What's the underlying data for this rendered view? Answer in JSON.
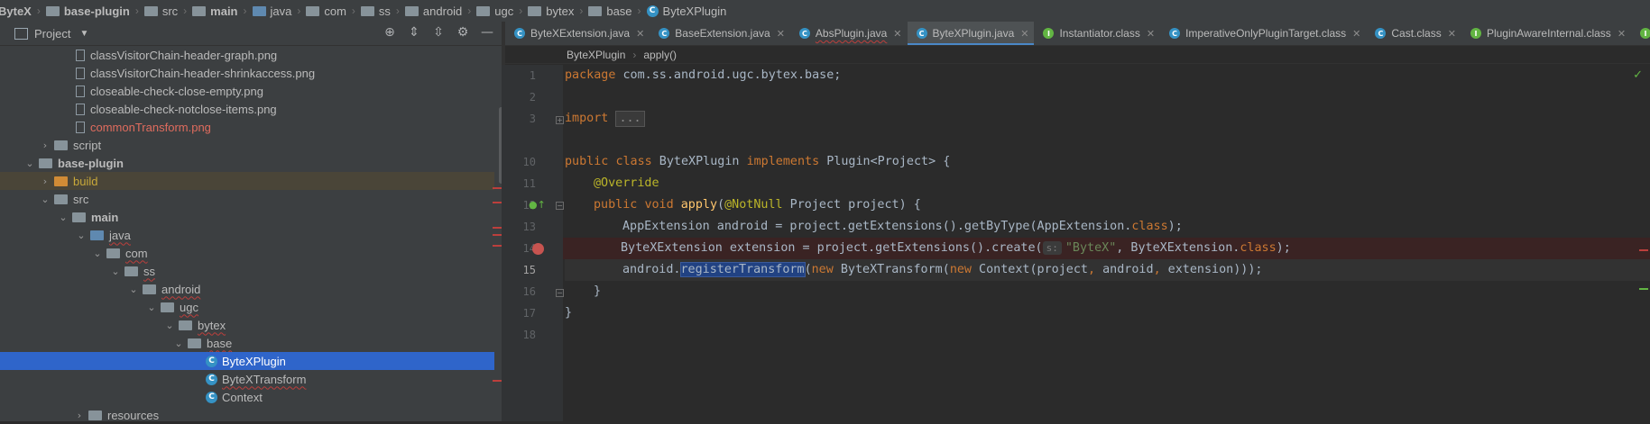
{
  "navbar": {
    "crumbs": [
      "ByteX",
      "base-plugin",
      "src",
      "main",
      "java",
      "com",
      "ss",
      "android",
      "ugc",
      "bytex",
      "base",
      "ByteXPlugin"
    ]
  },
  "project_panel": {
    "title": "Project",
    "tree": [
      {
        "label": "classVisitorChain-header-graph.png",
        "kind": "png"
      },
      {
        "label": "classVisitorChain-header-shrinkaccess.png",
        "kind": "png"
      },
      {
        "label": "closeable-check-close-empty.png",
        "kind": "png"
      },
      {
        "label": "closeable-check-notclose-items.png",
        "kind": "png"
      },
      {
        "label": "commonTransform.png",
        "kind": "png-red"
      },
      {
        "label": "script",
        "kind": "folder"
      },
      {
        "label": "base-plugin",
        "kind": "module"
      },
      {
        "label": "build",
        "kind": "folder-build"
      },
      {
        "label": "src",
        "kind": "folder"
      },
      {
        "label": "main",
        "kind": "folder"
      },
      {
        "label": "java",
        "kind": "folder-src"
      },
      {
        "label": "com",
        "kind": "folder"
      },
      {
        "label": "ss",
        "kind": "folder"
      },
      {
        "label": "android",
        "kind": "folder"
      },
      {
        "label": "ugc",
        "kind": "folder"
      },
      {
        "label": "bytex",
        "kind": "folder"
      },
      {
        "label": "base",
        "kind": "folder"
      },
      {
        "label": "ByteXPlugin",
        "kind": "class-selected"
      },
      {
        "label": "ByteXTransform",
        "kind": "class"
      },
      {
        "label": "Context",
        "kind": "class"
      },
      {
        "label": "resources",
        "kind": "folder"
      }
    ]
  },
  "tabs": [
    {
      "label": "ByteXExtension.java",
      "icon": "class-icon"
    },
    {
      "label": "BaseExtension.java",
      "icon": "class-icon"
    },
    {
      "label": "AbsPlugin.java",
      "icon": "class-icon"
    },
    {
      "label": "ByteXPlugin.java",
      "icon": "class-icon",
      "active": true
    },
    {
      "label": "Instantiator.class",
      "icon": "interface-icon"
    },
    {
      "label": "ImperativeOnlyPluginTarget.class",
      "icon": "class-icon"
    },
    {
      "label": "Cast.class",
      "icon": "class-icon"
    },
    {
      "label": "PluginAwareInternal.class",
      "icon": "interface-icon"
    }
  ],
  "editor_breadcrumb": [
    "ByteXPlugin",
    "apply()"
  ],
  "code": {
    "line_numbers": [
      "1",
      "2",
      "3",
      "10",
      "11",
      "12",
      "13",
      "14",
      "15",
      "16",
      "17",
      "18"
    ],
    "package_kw": "package",
    "package_name": " com.ss.android.ugc.bytex.base;",
    "import_kw": "import",
    "import_fold": "...",
    "l10_public": "public",
    "l10_class": "class",
    "l10_name": " ByteXPlugin ",
    "l10_implements": "implements",
    "l10_rest": " Plugin<Project> {",
    "l11_override": "@Override",
    "l12_public": "public",
    "l12_void": "void",
    "l12_fn": "apply",
    "l12_paren": "(",
    "l12_ann": "@NotNull",
    "l12_rest": " Project project) {",
    "l13_a": "AppExtension android = project.getExtensions().getByType(AppExtension.",
    "l13_class": "class",
    "l13_b": ");",
    "l14_a": "ByteXExtension extension = project.getExtensions().create(",
    "l14_hint": "s:",
    "l14_str": "\"ByteX\"",
    "l14_b": ", ByteXExtension.",
    "l14_class": "class",
    "l14_c": ");",
    "l15_a": "android.",
    "l15_sel": "registerTransform",
    "l15_b": "(",
    "l15_new1": "new",
    "l15_c": " ByteXTransform(",
    "l15_new2": "new",
    "l15_d": " Context(project",
    "l15_comma1": ",",
    "l15_e": " android",
    "l15_comma2": ",",
    "l15_f": " extension)));",
    "l16": "}",
    "l17": "}"
  }
}
